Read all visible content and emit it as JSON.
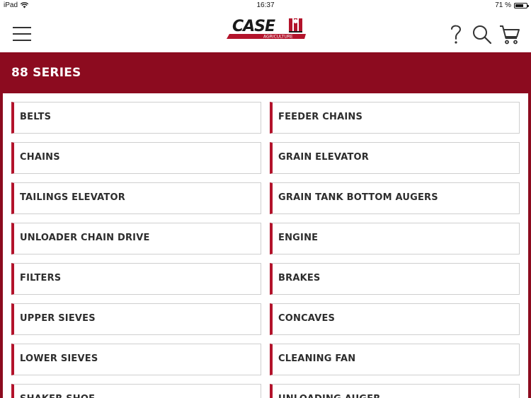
{
  "status_bar": {
    "device": "iPad",
    "time": "16:37",
    "battery": "71 %",
    "battery_level": 0.71
  },
  "header": {
    "logo_brand": "CASE",
    "logo_sub": "AGRICULTURE",
    "icons": {
      "menu": "hamburger-icon",
      "help": "question-icon",
      "search": "search-icon",
      "cart": "cart-icon"
    }
  },
  "title": "88 SERIES",
  "colors": {
    "brand_red": "#8c0b1f",
    "accent_red": "#b3132b",
    "text": "#2d2d2d"
  },
  "categories": [
    {
      "label": "BELTS"
    },
    {
      "label": "FEEDER CHAINS"
    },
    {
      "label": "CHAINS"
    },
    {
      "label": "GRAIN ELEVATOR"
    },
    {
      "label": "TAILINGS ELEVATOR"
    },
    {
      "label": "GRAIN TANK BOTTOM AUGERS"
    },
    {
      "label": "UNLOADER CHAIN DRIVE"
    },
    {
      "label": "ENGINE"
    },
    {
      "label": "FILTERS"
    },
    {
      "label": "BRAKES"
    },
    {
      "label": "UPPER SIEVES"
    },
    {
      "label": "CONCAVES"
    },
    {
      "label": "LOWER SIEVES"
    },
    {
      "label": "CLEANING FAN"
    },
    {
      "label": "SHAKER SHOE"
    },
    {
      "label": "UNLOADING AUGER"
    }
  ]
}
